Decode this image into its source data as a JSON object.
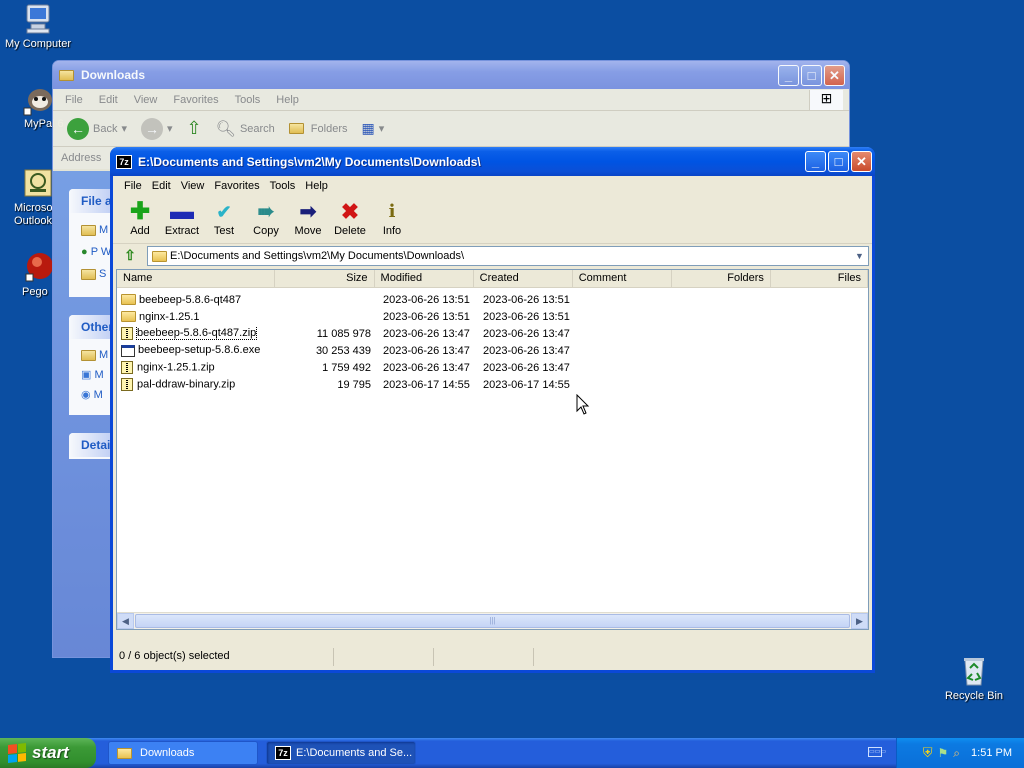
{
  "desktop": {
    "icons": [
      {
        "label": "My Computer"
      },
      {
        "label": "MyPal 6"
      },
      {
        "label": "Microsoft Outlook"
      },
      {
        "label": "Pego"
      },
      {
        "label": "Recycle Bin"
      }
    ]
  },
  "explorer": {
    "title": "Downloads",
    "menu": [
      "File",
      "Edit",
      "View",
      "Favorites",
      "Tools",
      "Help"
    ],
    "toolbar": {
      "back": "Back",
      "search": "Search",
      "folders": "Folders"
    },
    "address_label": "Address",
    "panels": [
      {
        "header": "File a",
        "items": [
          "M",
          "P\nW",
          "S"
        ]
      },
      {
        "header": "Other",
        "items": [
          "M",
          "M",
          "M"
        ]
      },
      {
        "header": "Detai"
      }
    ]
  },
  "sevenzip": {
    "title": "E:\\Documents and Settings\\vm2\\My Documents\\Downloads\\",
    "menu": [
      "File",
      "Edit",
      "View",
      "Favorites",
      "Tools",
      "Help"
    ],
    "toolbar": [
      {
        "label": "Add",
        "icon": "plus-icon",
        "color": "#1aa41a"
      },
      {
        "label": "Extract",
        "icon": "minus-icon",
        "color": "#1d2bb5"
      },
      {
        "label": "Test",
        "icon": "check-icon",
        "color": "#2ab3c8"
      },
      {
        "label": "Copy",
        "icon": "double-arrow-icon",
        "color": "#2a8b8b"
      },
      {
        "label": "Move",
        "icon": "arrow-right-icon",
        "color": "#1a1f7a"
      },
      {
        "label": "Delete",
        "icon": "x-icon",
        "color": "#d01515"
      },
      {
        "label": "Info",
        "icon": "info-icon",
        "color": "#7a6a10"
      }
    ],
    "address": "E:\\Documents and Settings\\vm2\\My Documents\\Downloads\\",
    "columns": {
      "name": "Name",
      "size": "Size",
      "modified": "Modified",
      "created": "Created",
      "comment": "Comment",
      "folders": "Folders",
      "files": "Files"
    },
    "files": [
      {
        "name": "beebeep-5.8.6-qt487",
        "size": "",
        "modified": "2023-06-26 13:51",
        "created": "2023-06-26 13:51",
        "type": "folder"
      },
      {
        "name": "nginx-1.25.1",
        "size": "",
        "modified": "2023-06-26 13:51",
        "created": "2023-06-26 13:51",
        "type": "folder"
      },
      {
        "name": "beebeep-5.8.6-qt487.zip",
        "size": "11 085 978",
        "modified": "2023-06-26 13:47",
        "created": "2023-06-26 13:47",
        "type": "zip"
      },
      {
        "name": "beebeep-setup-5.8.6.exe",
        "size": "30 253 439",
        "modified": "2023-06-26 13:47",
        "created": "2023-06-26 13:47",
        "type": "exe"
      },
      {
        "name": "nginx-1.25.1.zip",
        "size": "1 759 492",
        "modified": "2023-06-26 13:47",
        "created": "2023-06-26 13:47",
        "type": "zip"
      },
      {
        "name": "pal-ddraw-binary.zip",
        "size": "19 795",
        "modified": "2023-06-17 14:55",
        "created": "2023-06-17 14:55",
        "type": "zip"
      }
    ],
    "status": "0 / 6 object(s) selected"
  },
  "taskbar": {
    "start": "start",
    "tasks": [
      {
        "label": "Downloads"
      },
      {
        "label": "E:\\Documents and Se..."
      }
    ],
    "clock": "1:51 PM"
  }
}
